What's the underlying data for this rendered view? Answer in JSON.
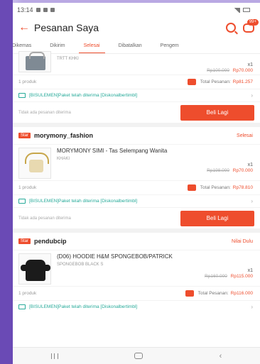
{
  "status_bar": {
    "time": "13:14"
  },
  "header": {
    "title": "Pesanan Saya",
    "chat_badge": "99+"
  },
  "tabs": [
    {
      "label": "Dikemas",
      "active": false
    },
    {
      "label": "Dikirim",
      "active": false
    },
    {
      "label": "Selesai",
      "active": true
    },
    {
      "label": "Dibatalkan",
      "active": false
    },
    {
      "label": "Pengem",
      "active": false
    }
  ],
  "orders": [
    {
      "shop_badge": "",
      "shop_name": "",
      "status": "",
      "product_name": "",
      "variant": "TRTT KHKI",
      "qty": "x1",
      "price_old": "Rp100.000",
      "price": "Rp70.000",
      "count": "1 produk",
      "total_label": "Total Pesanan:",
      "total_value": "Rp81.257",
      "shipping": "[BISULEMEN]Paket telah diterima [Diskonalbertimbl]",
      "hint": "Tidak ada pesanan diterima",
      "button": "Beli Lagi"
    },
    {
      "shop_badge": "Star",
      "shop_name": "morymony_fashion",
      "status": "Selesai",
      "product_name": "MORYMONY SIMI - Tas Selempang Wanita",
      "variant": "KHAKI",
      "qty": "x1",
      "price_old": "Rp198.000",
      "price": "Rp70.000",
      "count": "1 produk",
      "total_label": "Total Pesanan:",
      "total_value": "Rp78.810",
      "shipping": "[BISULEMEN]Paket telah diterima [Diskonalbertimbl]",
      "hint": "Tidak ada pesanan diterima",
      "button": "Beli Lagi"
    },
    {
      "shop_badge": "Star",
      "shop_name": "pendubcip",
      "status": "Nilai Dulu",
      "product_name": "(D06) HOODIE H&M SPONGEBOB/PATRICK",
      "variant": "SPONGEBOB BLACK S",
      "qty": "x1",
      "price_old": "Rp160.000",
      "price": "Rp115.000",
      "count": "1 produk",
      "total_label": "Total Pesanan:",
      "total_value": "Rp116.000",
      "shipping": "[BISULEMEN]Paket telah diterima [Diskonalbertimbl]"
    }
  ],
  "colors": {
    "accent": "#ee4d2d",
    "teal": "#26aa99",
    "frame": "#6a4ab5"
  }
}
